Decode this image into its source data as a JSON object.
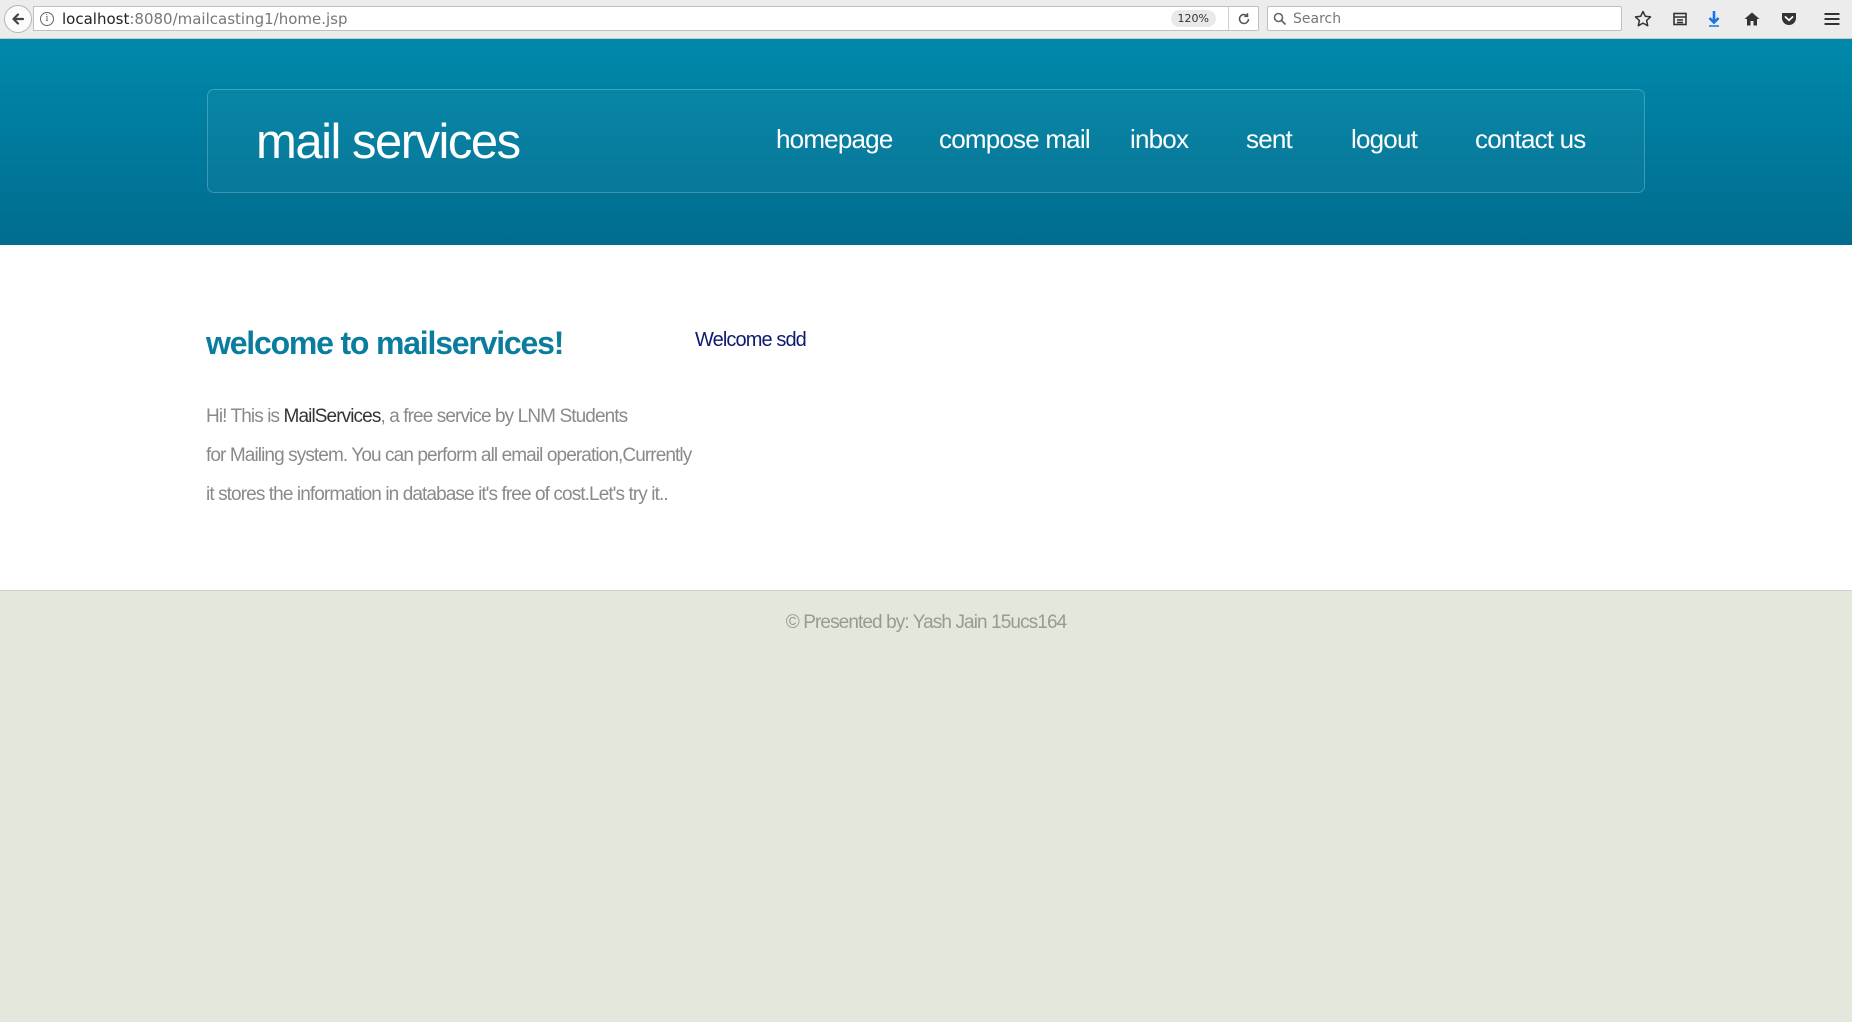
{
  "browser": {
    "url_host": "localhost",
    "url_path": ":8080/mailcasting1/home.jsp",
    "zoom": "120%",
    "search_placeholder": "Search",
    "icons": [
      "back-arrow-icon",
      "info-icon",
      "reload-icon",
      "search-icon",
      "star-icon",
      "reading-list-icon",
      "download-icon",
      "home-icon",
      "pocket-icon",
      "menu-icon"
    ],
    "download_icon_color": "#1a73e8"
  },
  "header": {
    "logo": "mail services",
    "nav": [
      {
        "label": "homepage"
      },
      {
        "label": "compose mail"
      },
      {
        "label": "inbox"
      },
      {
        "label": "sent"
      },
      {
        "label": "logout"
      },
      {
        "label": "contact us"
      }
    ],
    "gradient_top": "#0089ab",
    "gradient_bottom": "#006c8e"
  },
  "main": {
    "heading": "welcome to mailservices!",
    "intro": {
      "line1_before": "Hi! This is ",
      "brand": "MailServices",
      "line1_after": ", a free service by LNM Students",
      "line2": "for Mailing system. You can perform all email operation,Currently",
      "line3": "it stores the information in database it's free of cost.Let's try it.."
    },
    "user_greeting": "Welcome sdd",
    "heading_color": "#0a7d9f",
    "greeting_color": "#0e1a6e"
  },
  "footer": {
    "text": "© Presented by: Yash Jain  15ucs164"
  }
}
